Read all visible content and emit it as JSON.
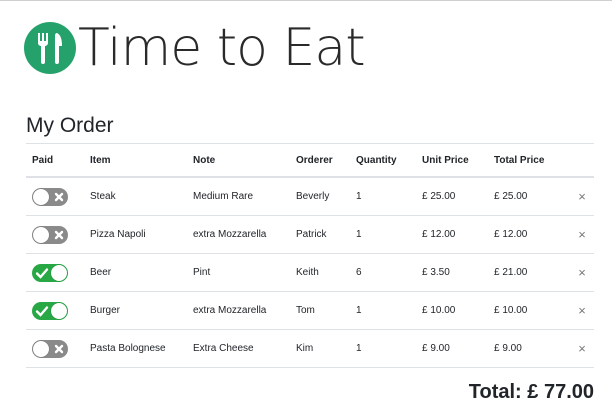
{
  "app": {
    "title": "Time to Eat",
    "logo_icon": "fork-knife-icon",
    "accent_color": "#25a26b"
  },
  "order": {
    "title": "My Order",
    "columns": [
      "Paid",
      "Item",
      "Note",
      "Orderer",
      "Quantity",
      "Unit Price",
      "Total Price"
    ],
    "rows": [
      {
        "paid": false,
        "item": "Steak",
        "note": "Medium Rare",
        "orderer": "Beverly",
        "quantity": "1",
        "unit_price": "£ 25.00",
        "total_price": "£ 25.00"
      },
      {
        "paid": false,
        "item": "Pizza Napoli",
        "note": "extra Mozzarella",
        "orderer": "Patrick",
        "quantity": "1",
        "unit_price": "£ 12.00",
        "total_price": "£ 12.00"
      },
      {
        "paid": true,
        "item": "Beer",
        "note": "Pint",
        "orderer": "Keith",
        "quantity": "6",
        "unit_price": "£ 3.50",
        "total_price": "£ 21.00"
      },
      {
        "paid": true,
        "item": "Burger",
        "note": "extra Mozzarella",
        "orderer": "Tom",
        "quantity": "1",
        "unit_price": "£ 10.00",
        "total_price": "£ 10.00"
      },
      {
        "paid": false,
        "item": "Pasta Bolognese",
        "note": "Extra Cheese",
        "orderer": "Kim",
        "quantity": "1",
        "unit_price": "£ 9.00",
        "total_price": "£ 9.00"
      }
    ],
    "delete_symbol": "×",
    "total_label": "Total: £ 77.00"
  },
  "colors": {
    "paid_on": "#28a745",
    "paid_off": "#8a8a8a"
  }
}
